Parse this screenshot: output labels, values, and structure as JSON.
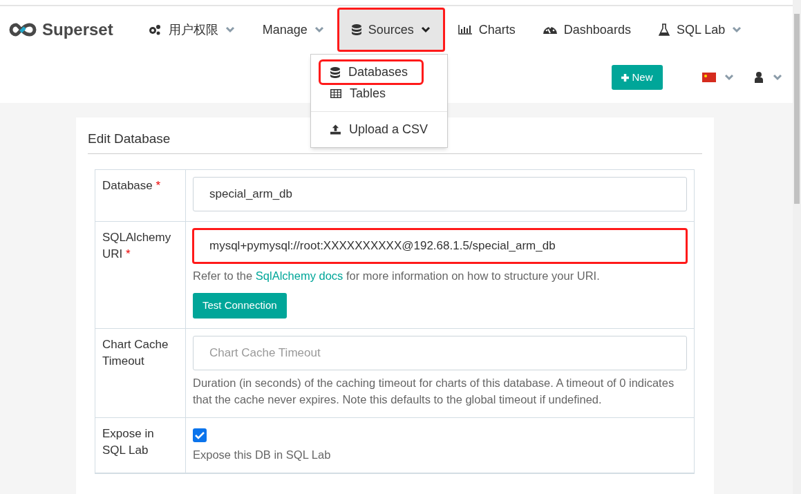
{
  "brand": {
    "name": "Superset"
  },
  "nav": [
    {
      "label": "用户权限",
      "dropdown": true,
      "selected": false,
      "highlighted": false
    },
    {
      "label": "Manage",
      "dropdown": true,
      "selected": false,
      "highlighted": false
    },
    {
      "label": "Sources",
      "dropdown": true,
      "selected": true,
      "highlighted": true
    },
    {
      "label": "Charts",
      "dropdown": false,
      "selected": false,
      "highlighted": false
    },
    {
      "label": "Dashboards",
      "dropdown": false,
      "selected": false,
      "highlighted": false
    },
    {
      "label": "SQL Lab",
      "dropdown": true,
      "selected": false,
      "highlighted": false
    }
  ],
  "menu": [
    {
      "kind": "item",
      "label": "Databases",
      "highlighted": true
    },
    {
      "kind": "item",
      "label": "Tables",
      "highlighted": false
    },
    {
      "kind": "divider"
    },
    {
      "kind": "item",
      "label": "Upload a CSV",
      "highlighted": false
    }
  ],
  "new_button": {
    "label": "New"
  },
  "form": {
    "title": "Edit Database",
    "rows": [
      {
        "label": "Database",
        "required_mark": "*",
        "kind": "input",
        "value": "special_arm_db",
        "highlighted": false
      },
      {
        "label": "SQLAlchemy URI",
        "required_mark": "*",
        "kind": "input",
        "value": "mysql+pymysql://root:XXXXXXXXXX@192.68.1.5/special_arm_db",
        "highlighted": true,
        "help": "Refer to the ",
        "link": "SqlAlchemy docs",
        "help_after": " for more information on how to structure your URI.",
        "button": "Test Connection"
      },
      {
        "label": "Chart Cache Timeout",
        "kind": "input",
        "placeholder": "Chart Cache Timeout",
        "highlighted": false,
        "help": "Duration (in seconds) of the caching timeout for charts of this database. A timeout of 0 indicates that the cache never expires. Note this defaults to the global timeout if undefined."
      },
      {
        "label": "Expose in SQL Lab",
        "kind": "checkbox",
        "checked": true,
        "help": "Expose this DB in SQL Lab"
      }
    ]
  }
}
